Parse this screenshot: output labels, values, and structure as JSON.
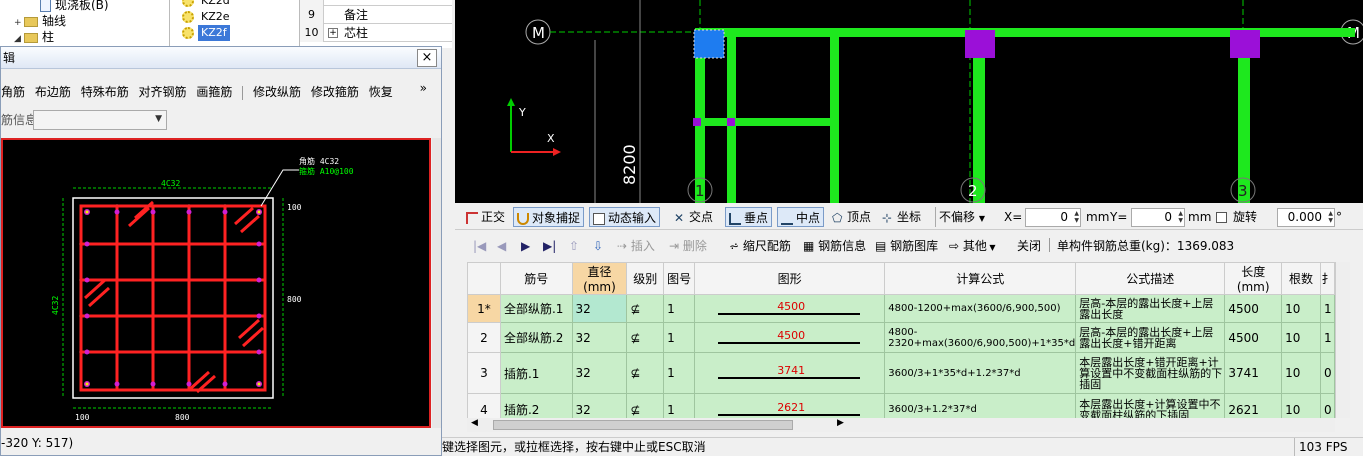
{
  "tree": {
    "items": [
      {
        "label": "现浇板(B)",
        "level": 3
      },
      {
        "label": "轴线",
        "level": 1
      },
      {
        "label": "柱",
        "level": 1
      }
    ]
  },
  "components": [
    "KZ2d",
    "KZ2e",
    "KZ2f"
  ],
  "selected_component": "KZ2f",
  "property_rows": [
    {
      "num": "",
      "label": ""
    },
    {
      "num": "9",
      "label": "备注"
    },
    {
      "num": "10",
      "label": "芯柱"
    }
  ],
  "editor": {
    "title": "辑",
    "close_label": "×",
    "toolbar": [
      "角筋",
      "布边筋",
      "特殊布筋",
      "对齐钢筋",
      "画箍筋",
      "修改纵筋",
      "修改箍筋",
      "恢复"
    ],
    "more": "»",
    "info_label": "筋信息",
    "status": "-320 Y: 517)",
    "drawing": {
      "callout_1": "角筋  4C32",
      "callout_2": "箍筋  A10@100",
      "top_label": "4C32",
      "side_label": "4C32",
      "dim_right_top": "100",
      "dim_right_mid": "800",
      "dim_bottom_left": "100",
      "dim_bottom_mid": "800"
    }
  },
  "cad": {
    "axis_left": "M",
    "axis_right": "M",
    "dim_vertical": "8200",
    "grid_labels": [
      "1",
      "2",
      "3"
    ],
    "ucs_y": "Y",
    "ucs_x": "X"
  },
  "snapbar": {
    "ortho": "正交",
    "object_snap": "对象捕捉",
    "dynamic_input": "动态输入",
    "intersection": "交点",
    "perpendicular": "垂点",
    "midpoint": "中点",
    "vertex": "顶点",
    "coordinate": "坐标",
    "offset_mode": "不偏移",
    "x_label": "X=",
    "x_value": "0",
    "unit_mm_1": "mm",
    "y_label": "Y=",
    "y_value": "0",
    "unit_mm_2": "mm",
    "rotate_label": "旋转",
    "rotate_value": "0.000",
    "deg": "°"
  },
  "gridbar": {
    "insert": "插入",
    "delete": "删除",
    "scale_rebar": "缩尺配筋",
    "rebar_info": "钢筋信息",
    "rebar_library": "钢筋图库",
    "other": "其他",
    "close": "关闭",
    "total_weight": "单构件钢筋总重(kg)：1369.083"
  },
  "table": {
    "headers": [
      "",
      "筋号",
      "直径(mm)",
      "级别",
      "图号",
      "图形",
      "计算公式",
      "公式描述",
      "长度(mm)",
      "根数",
      "扌"
    ],
    "rows": [
      {
        "rn": "1*",
        "name": "全部纵筋.1",
        "dia": "32",
        "grade": "⊈",
        "fig": "1",
        "shape": "4500",
        "formula": "4800-1200+max(3600/6,900,500)",
        "desc": "层高-本层的露出长度+上层露出长度",
        "length": "4500",
        "count": "10",
        "extra": "1"
      },
      {
        "rn": "2",
        "name": "全部纵筋.2",
        "dia": "32",
        "grade": "⊈",
        "fig": "1",
        "shape": "4500",
        "formula": "4800-2320+max(3600/6,900,500)+1*35*d",
        "desc": "层高-本层的露出长度+上层露出长度+错开距离",
        "length": "4500",
        "count": "10",
        "extra": "1"
      },
      {
        "rn": "3",
        "name": "插筋.1",
        "dia": "32",
        "grade": "⊈",
        "fig": "1",
        "shape": "3741",
        "formula": "3600/3+1*35*d+1.2*37*d",
        "desc": "本层露出长度+错开距离+计算设置中不变截面柱纵筋的下插固",
        "length": "3741",
        "count": "10",
        "extra": "0"
      },
      {
        "rn": "4",
        "name": "插筋.2",
        "dia": "32",
        "grade": "⊈",
        "fig": "1",
        "shape": "2621",
        "formula": "3600/3+1.2*37*d",
        "desc": "本层露出长度+计算设置中不变截面柱纵筋的下插固",
        "length": "2621",
        "count": "10",
        "extra": "0"
      }
    ]
  },
  "status": {
    "hint": "键选择图元，或拉框选择，按右键中止或ESC取消",
    "fps": "103 FPS"
  }
}
